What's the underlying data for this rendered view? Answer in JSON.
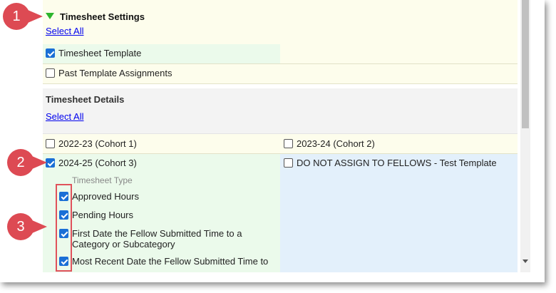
{
  "settings": {
    "title": "Timesheet Settings",
    "select_all": "Select All",
    "items": [
      {
        "label": "Timesheet Template",
        "checked": true
      },
      {
        "label": "Past Template Assignments",
        "checked": false
      }
    ]
  },
  "details": {
    "title": "Timesheet Details",
    "select_all": "Select All",
    "cohorts": [
      {
        "label": "2022-23 (Cohort 1)",
        "checked": false
      },
      {
        "label": "2023-24 (Cohort 2)",
        "checked": false
      },
      {
        "label": "2024-25 (Cohort 3)",
        "checked": true
      },
      {
        "label": "DO NOT ASSIGN TO FELLOWS - Test Template",
        "checked": false
      }
    ],
    "type_heading": "Timesheet Type",
    "types": [
      {
        "label": "Approved Hours",
        "checked": true
      },
      {
        "label": "Pending Hours",
        "checked": true
      },
      {
        "label_line1": "First Date the Fellow Submitted Time to a",
        "label_line2": "Category or Subcategory",
        "checked": true
      },
      {
        "label": "Most Recent Date the Fellow Submitted Time to",
        "checked": true
      }
    ]
  },
  "callouts": [
    "1",
    "2",
    "3"
  ],
  "colors": {
    "callout": "#dd4a53",
    "header_bg": "#fdfdec",
    "checked_row": "#ebfaeb",
    "blue_cell": "#e3f0fb",
    "link": "#0000ee"
  }
}
